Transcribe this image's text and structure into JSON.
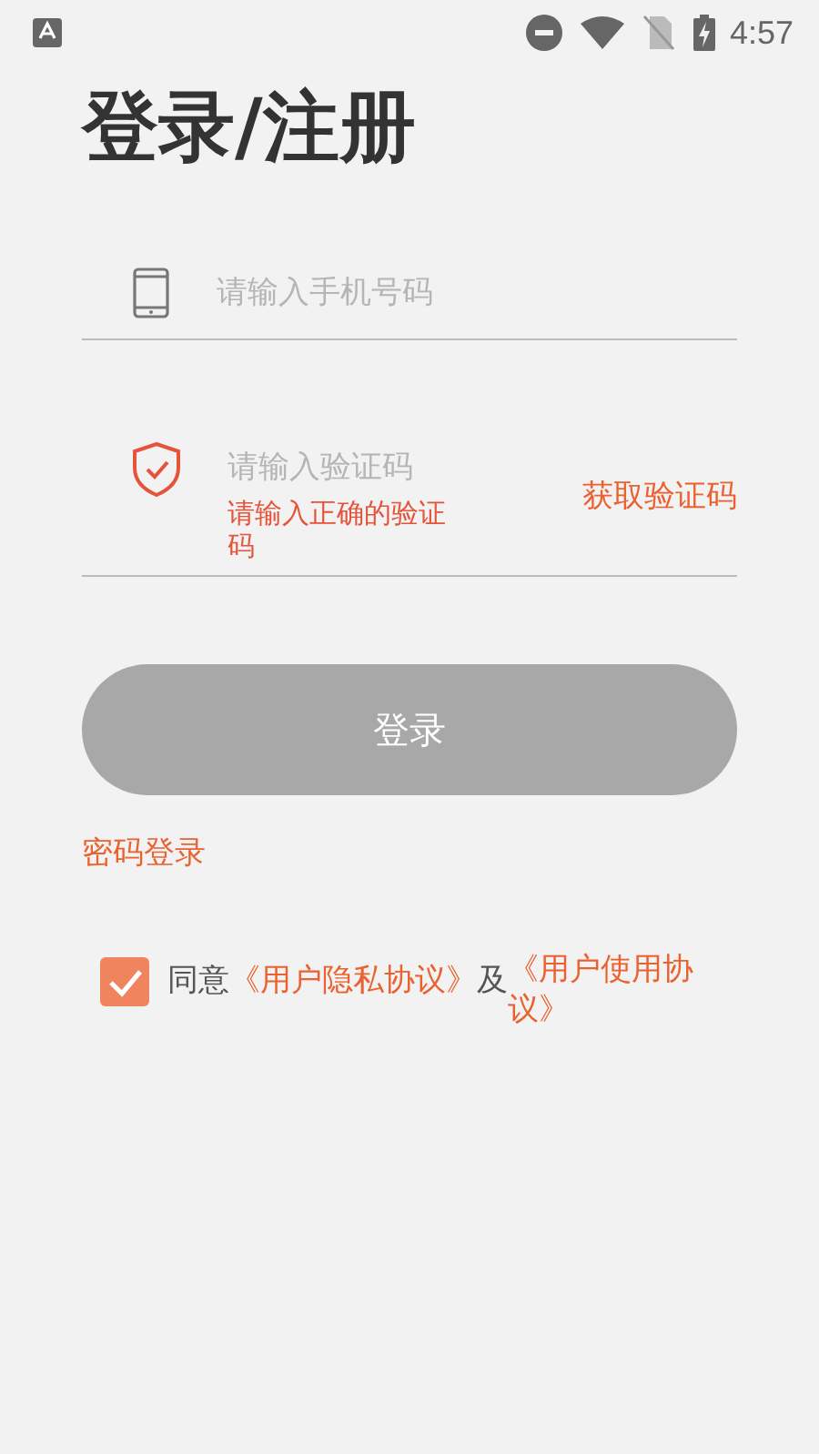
{
  "status_bar": {
    "time": "4:57"
  },
  "title": "登录/注册",
  "phone_field": {
    "placeholder": "请输入手机号码"
  },
  "code_field": {
    "placeholder": "请输入验证码",
    "error": "请输入正确的验证码",
    "get_code_button": "获取验证码"
  },
  "login_button": {
    "label": "登录",
    "disabled": true
  },
  "password_login_link": "密码登录",
  "agreement": {
    "checked": true,
    "prefix": "同意",
    "privacy_link": "《用户隐私协议》",
    "conjunction": "及",
    "terms_link": "《用户使用协议》"
  }
}
